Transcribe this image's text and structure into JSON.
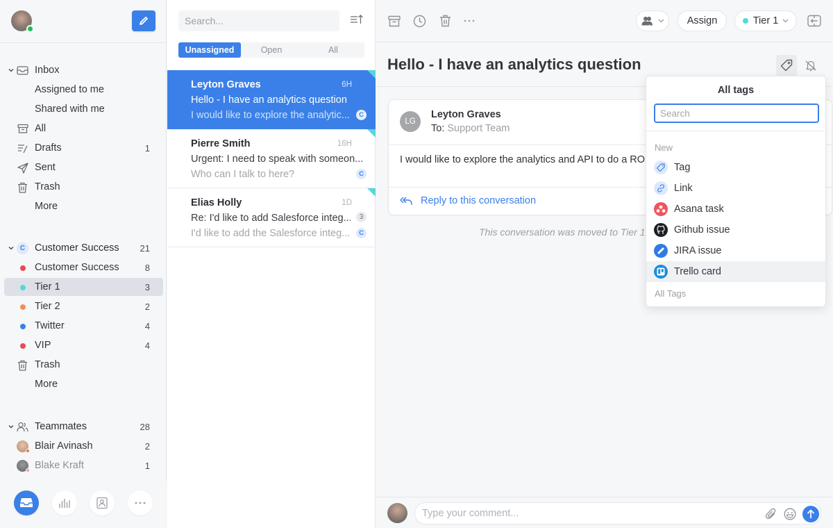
{
  "sidebar": {
    "compose_label": "Compose",
    "inbox": {
      "label": "Inbox",
      "items": [
        {
          "label": "Assigned to me",
          "count": ""
        },
        {
          "label": "Shared with me",
          "count": ""
        },
        {
          "label": "All",
          "count": ""
        },
        {
          "label": "Drafts",
          "count": "1"
        },
        {
          "label": "Sent",
          "count": ""
        },
        {
          "label": "Trash",
          "count": ""
        },
        {
          "label": "More",
          "count": ""
        }
      ]
    },
    "team": {
      "label": "Customer Success",
      "badge": "C",
      "count": "21",
      "items": [
        {
          "label": "Customer Success",
          "count": "8",
          "color": "#e84a55"
        },
        {
          "label": "Tier 1",
          "count": "3",
          "color": "#52d9dc"
        },
        {
          "label": "Tier 2",
          "count": "2",
          "color": "#ee9256"
        },
        {
          "label": "Twitter",
          "count": "4",
          "color": "#3a80e8"
        },
        {
          "label": "VIP",
          "count": "4",
          "color": "#e84a55"
        },
        {
          "label": "Trash",
          "count": ""
        },
        {
          "label": "More",
          "count": ""
        }
      ]
    },
    "teammates": {
      "label": "Teammates",
      "count": "28",
      "items": [
        {
          "label": "Blair Avinash",
          "count": "2",
          "status_color": "#ee7a3a"
        },
        {
          "label": "Blake Kraft",
          "count": "1",
          "status_color": "#f2a3a0"
        }
      ]
    },
    "bottom_nav": [
      "inbox",
      "analytics",
      "contacts",
      "more"
    ]
  },
  "list": {
    "search_placeholder": "Search...",
    "tabs": [
      {
        "label": "Unassigned",
        "active": true
      },
      {
        "label": "Open",
        "active": false
      },
      {
        "label": "All",
        "active": false
      }
    ],
    "conversations": [
      {
        "name": "Leyton Graves",
        "time": "6H",
        "subject": "Hello - I have an analytics question",
        "preview": "I would like to explore the analytic...",
        "badge": "C",
        "count": "",
        "selected": true
      },
      {
        "name": "Pierre Smith",
        "time": "16H",
        "subject": "Urgent: I need to speak with someon...",
        "preview": "Who can I talk to here?",
        "badge": "C",
        "count": "",
        "selected": false
      },
      {
        "name": "Elias Holly",
        "time": "1D",
        "subject": "Re: I'd like to add Salesforce integ...",
        "preview": "I'd like to add the Salesforce integ...",
        "badge": "C",
        "count": "3",
        "selected": false
      }
    ]
  },
  "main": {
    "toolbar": {
      "assign_label": "Assign",
      "tag_label": "Tier 1",
      "tag_color": "#52d9dc"
    },
    "subject": "Hello - I have an analytics question",
    "message": {
      "avatar_initials": "LG",
      "from": "Leyton Graves",
      "to_label": "To:",
      "to": "Support Team",
      "body": "I would like to explore the analytics and API to do a ROI resources.",
      "reply_label": "Reply to this conversation"
    },
    "event_text": "This conversation was moved to Tier 1",
    "composer": {
      "placeholder": "Type your comment..."
    }
  },
  "tags_popover": {
    "title": "All tags",
    "search_placeholder": "Search",
    "section_new": "New",
    "items": [
      {
        "label": "Tag",
        "icon": "tag-icon"
      },
      {
        "label": "Link",
        "icon": "link-icon"
      },
      {
        "label": "Asana task",
        "icon": "asana-icon"
      },
      {
        "label": "Github issue",
        "icon": "github-icon"
      },
      {
        "label": "JIRA issue",
        "icon": "jira-icon"
      },
      {
        "label": "Trello card",
        "icon": "trello-icon"
      }
    ],
    "section_all": "All Tags"
  },
  "colors": {
    "accent": "#3a80e8",
    "tier1": "#52d9dc",
    "online": "#1fbf4f"
  }
}
